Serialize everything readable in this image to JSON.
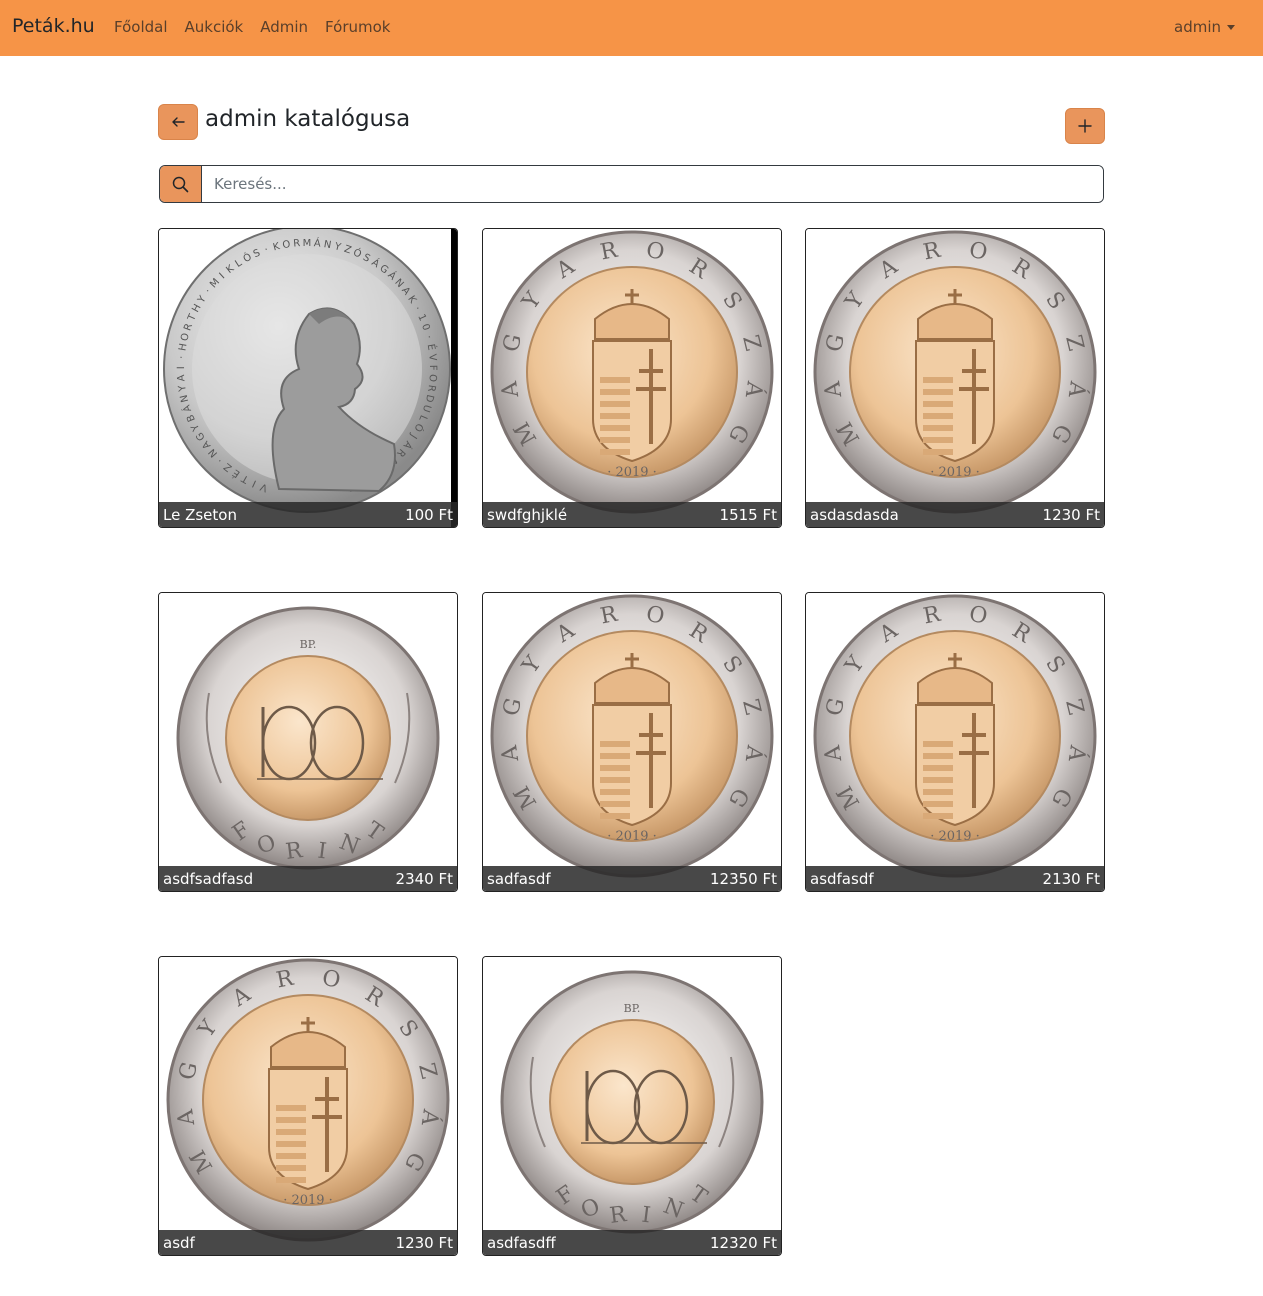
{
  "navbar": {
    "brand": "Peták.hu",
    "links": [
      "Főoldal",
      "Aukciók",
      "Admin",
      "Fórumok"
    ],
    "user": "admin"
  },
  "page": {
    "title": "admin katalógusa",
    "back_icon": "arrow-left-icon",
    "add_icon": "plus-icon"
  },
  "search": {
    "placeholder": "Keresés...",
    "icon": "search-icon"
  },
  "colors": {
    "navbar": "#f69447",
    "button": "#e9955c",
    "caption_bg": "#333333"
  },
  "items": [
    {
      "name": "Le Zseton",
      "price": "100 Ft",
      "image": "horthy-silver-coin"
    },
    {
      "name": "swdfghjklé",
      "price": "1515 Ft",
      "image": "coat-of-arms-coin"
    },
    {
      "name": "asdasdasda",
      "price": "1230 Ft",
      "image": "coat-of-arms-coin"
    },
    {
      "name": "asdfsadfasd",
      "price": "2340 Ft",
      "image": "100-forint-coin"
    },
    {
      "name": "sadfasdf",
      "price": "12350 Ft",
      "image": "coat-of-arms-coin"
    },
    {
      "name": "asdfasdf",
      "price": "2130 Ft",
      "image": "coat-of-arms-coin"
    },
    {
      "name": "asdf",
      "price": "1230 Ft",
      "image": "coat-of-arms-coin"
    },
    {
      "name": "asdfasdff",
      "price": "12320 Ft",
      "image": "100-forint-coin"
    }
  ]
}
